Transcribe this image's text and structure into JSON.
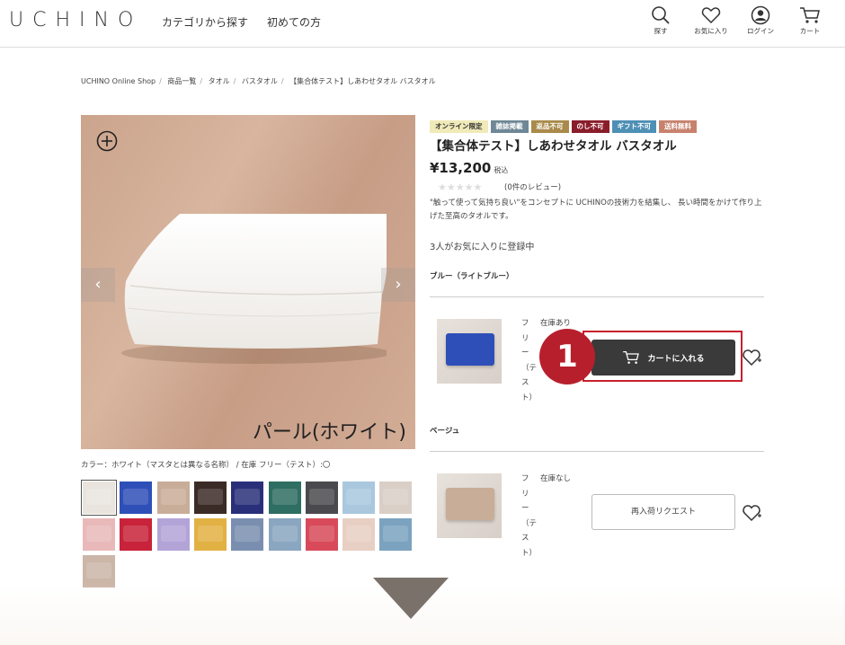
{
  "header": {
    "logo": "UCHINO",
    "nav": [
      "カテゴリから探す",
      "初めての方"
    ],
    "icons": [
      {
        "name": "search-icon",
        "label": "探す"
      },
      {
        "name": "heart-icon",
        "label": "お気に入り"
      },
      {
        "name": "user-icon",
        "label": "ログイン"
      },
      {
        "name": "cart-icon",
        "label": "カート"
      }
    ]
  },
  "breadcrumb": [
    "UCHINO Online Shop",
    "商品一覧",
    "タオル",
    "バスタオル",
    "【集合体テスト】しあわせタオル バスタオル"
  ],
  "gallery": {
    "image_caption": "パール(ホワイト)",
    "color_caption": "カラー：ホワイト（マスタとは異なる名称） / 在庫 フリー（テスト）:〇",
    "prev_icon": "chevron-left-icon",
    "next_icon": "chevron-right-icon",
    "zoom_icon": "zoom-plus-icon",
    "thumbnail_colors": [
      "#e9e4de",
      "#2f4fb8",
      "#c8ad98",
      "#3b2b26",
      "#2a2f7a",
      "#2f6e62",
      "#4a4a4e",
      "#a9c8de",
      "#d9cfc6",
      "#e9b9b9",
      "#c8233a",
      "#b3a4d8",
      "#e2b144",
      "#7a8fb0",
      "#8aa6c0",
      "#d84a5a",
      "#e8cfc4",
      "#7ba3c0",
      "#cbb6a8"
    ],
    "selected_thumbnail": 0
  },
  "product": {
    "badges": [
      {
        "label": "オンライン限定",
        "bg": "#f0eab8",
        "fg": "#333333"
      },
      {
        "label": "雑誌掲載",
        "bg": "#6f8796",
        "fg": "#ffffff"
      },
      {
        "label": "返品不可",
        "bg": "#a98a4a",
        "fg": "#ffffff"
      },
      {
        "label": "のし不可",
        "bg": "#8a1d2a",
        "fg": "#ffffff"
      },
      {
        "label": "ギフト不可",
        "bg": "#4e8fb5",
        "fg": "#ffffff"
      },
      {
        "label": "送料無料",
        "bg": "#c7826e",
        "fg": "#ffffff"
      }
    ],
    "title": "【集合体テスト】しあわせタオル バスタオル",
    "price": "¥13,200",
    "tax_label": "税込",
    "stars": "★★★★★",
    "rating": 0,
    "reviews": "(0件のレビュー)",
    "description": "\"触って使って気持ち良い\"をコンセプトに UCHINOの技術力を結集し、 長い時間をかけて作り上げた至高のタオルです。",
    "favorite_count": "3人がお気に入りに登録中"
  },
  "variants": [
    {
      "group": "ブルー（ライトブルー）",
      "swatch": "#2f4fb8",
      "size": "フリー（テスト）",
      "stock": "在庫あり",
      "button": "カートに入れる",
      "button_icon": "cart-icon"
    },
    {
      "group": "ベージュ",
      "swatch": "#c8ad98",
      "size": "フリー（テスト）",
      "stock": "在庫なし",
      "button": "再入荷リクエスト"
    }
  ],
  "annotation": {
    "step": "1",
    "color": "#c8202d"
  }
}
